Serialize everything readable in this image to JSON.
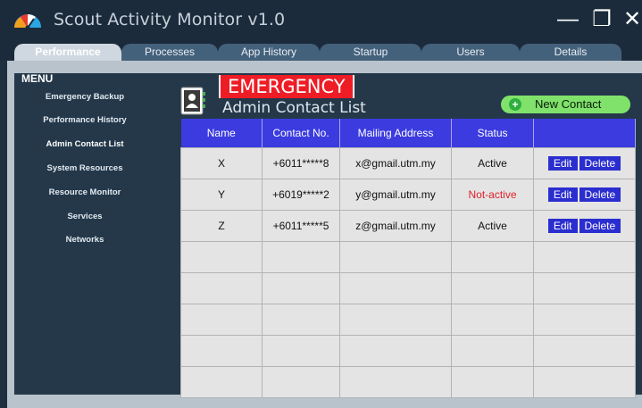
{
  "window": {
    "title": "Scout Activity Monitor v1.0",
    "minimize": "—",
    "maximize": "❐",
    "close": "✕"
  },
  "tabs": [
    {
      "label": "Performance",
      "active": true
    },
    {
      "label": "Processes",
      "active": false
    },
    {
      "label": "App History",
      "active": false
    },
    {
      "label": "Startup",
      "active": false
    },
    {
      "label": "Users",
      "active": false
    },
    {
      "label": "Details",
      "active": false
    }
  ],
  "sidebar": {
    "title": "MENU",
    "items": [
      {
        "label": "Emergency Backup"
      },
      {
        "label": "Performance History"
      },
      {
        "label": "Admin Contact List",
        "active": true
      },
      {
        "label": "System Resources"
      },
      {
        "label": "Resource Monitor"
      },
      {
        "label": "Services"
      },
      {
        "label": "Networks"
      }
    ]
  },
  "main": {
    "badge": "EMERGENCY",
    "subtitle": "Admin Contact List",
    "new_contact_label": "New Contact",
    "plus": "+"
  },
  "table": {
    "headers": [
      "Name",
      "Contact No.",
      "Mailing Address",
      "Status",
      ""
    ],
    "rows": [
      {
        "name": "X",
        "contact": "+6011*****8",
        "email": "x@gmail.utm.my",
        "status": "Active",
        "edit": "Edit",
        "delete": "Delete"
      },
      {
        "name": "Y",
        "contact": "+6019*****2",
        "email": "y@gmail.utm.my",
        "status": "Not-active",
        "edit": "Edit",
        "delete": "Delete"
      },
      {
        "name": "Z",
        "contact": "+6011*****5",
        "email": "z@gmail.utm.my",
        "status": "Active",
        "edit": "Edit",
        "delete": "Delete"
      }
    ],
    "empty_rows": 5
  },
  "colors": {
    "accent": "#3b3be0",
    "emergency": "#ee1c25",
    "new_contact": "#80e26b",
    "not_active": "#e0202a"
  }
}
